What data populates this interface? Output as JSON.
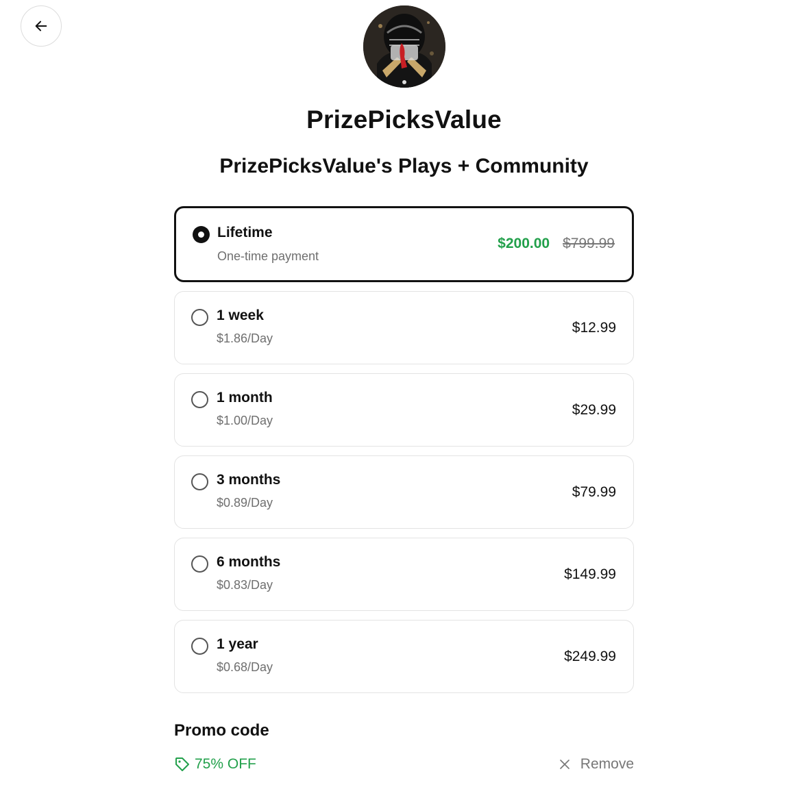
{
  "header": {
    "back_icon": "arrow-left-icon",
    "creator_name": "PrizePicksValue",
    "product_title": "PrizePicksValue's Plays + Community"
  },
  "plans": [
    {
      "name": "Lifetime",
      "sub": "One-time payment",
      "price": "$200.00",
      "original_price": "$799.99",
      "selected": true
    },
    {
      "name": "1 week",
      "sub": "$1.86/Day",
      "price": "$12.99",
      "selected": false
    },
    {
      "name": "1 month",
      "sub": "$1.00/Day",
      "price": "$29.99",
      "selected": false
    },
    {
      "name": "3 months",
      "sub": "$0.89/Day",
      "price": "$79.99",
      "selected": false
    },
    {
      "name": "6 months",
      "sub": "$0.83/Day",
      "price": "$149.99",
      "selected": false
    },
    {
      "name": "1 year",
      "sub": "$0.68/Day",
      "price": "$249.99",
      "selected": false
    }
  ],
  "promo": {
    "heading": "Promo code",
    "discount_label": "75% OFF",
    "tag_icon": "tag-icon",
    "remove_label": "Remove",
    "remove_icon": "close-icon"
  },
  "colors": {
    "accent_green": "#22a04b",
    "text_primary": "#111111",
    "text_muted": "#6f6f6f",
    "border": "#e3e3e3"
  }
}
